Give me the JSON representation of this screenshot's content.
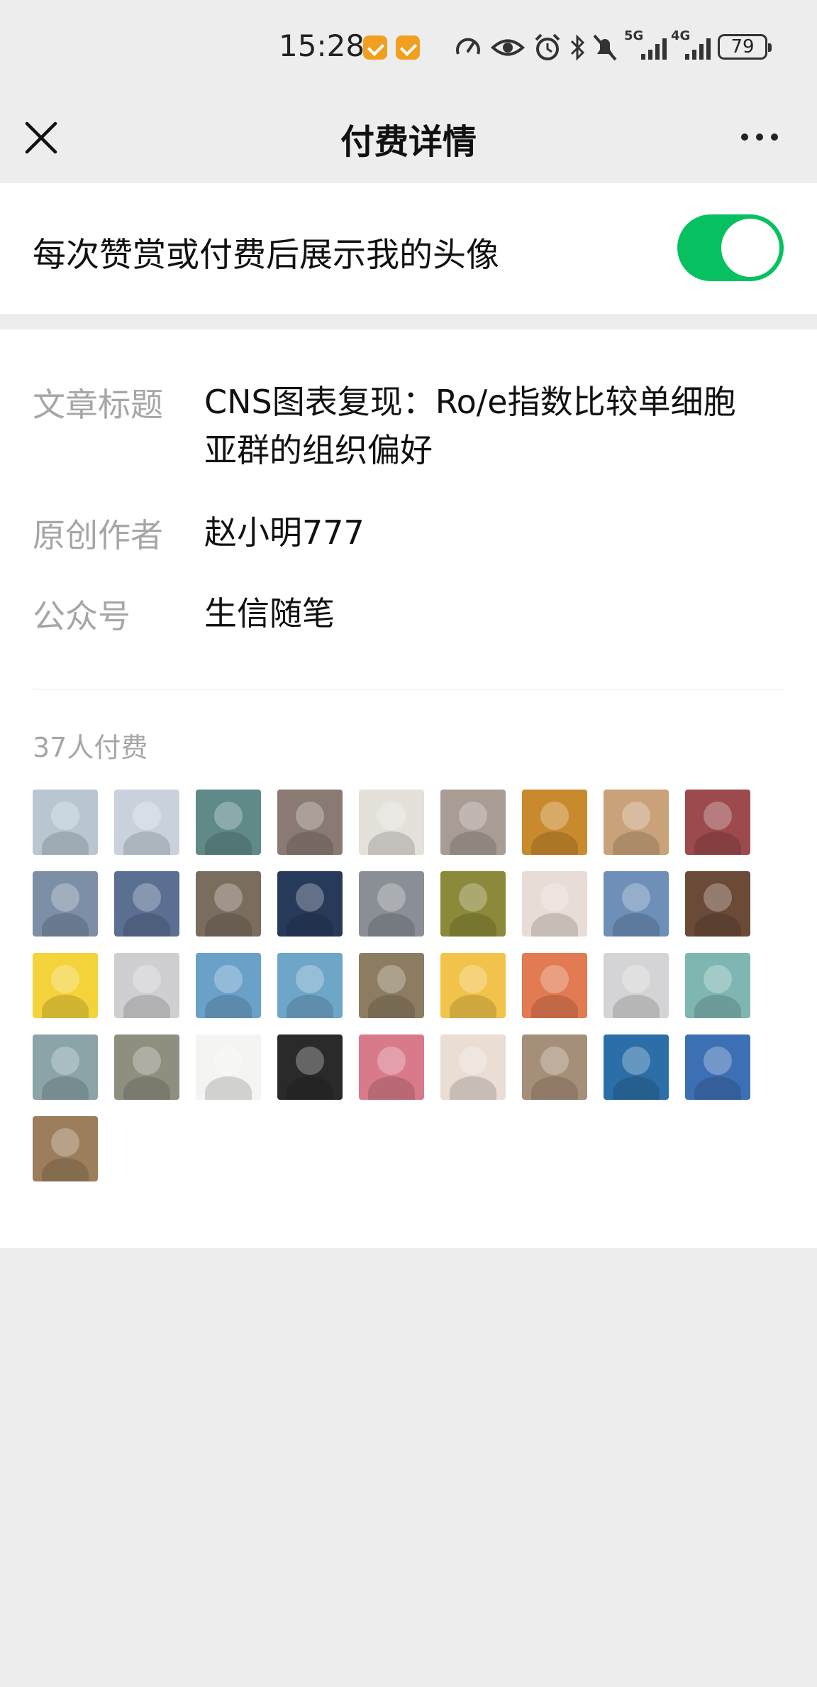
{
  "status_bar": {
    "time": "15:28",
    "network_1": "5G",
    "network_2": "4G",
    "battery": "79",
    "icons": [
      "app-notification-icon",
      "app-notification-icon",
      "speed-icon",
      "eye-icon",
      "alarm-icon",
      "bluetooth-icon",
      "mute-icon",
      "signal-icon",
      "signal-icon",
      "battery-icon"
    ]
  },
  "nav": {
    "title": "付费详情",
    "close_icon": "close-icon",
    "more_icon": "more-icon"
  },
  "toggle": {
    "label": "每次赞赏或付费后展示我的头像",
    "enabled": true,
    "accent_color": "#07c160"
  },
  "details": {
    "article_title_label": "文章标题",
    "article_title_line1": "CNS图表复现：Ro/e指数比较单细胞",
    "article_title_line2": "亚群的组织偏好",
    "author_label": "原创作者",
    "author_value": "赵小明777",
    "account_label": "公众号",
    "account_value": "生信随笔"
  },
  "payers": {
    "count_text": "37人付费",
    "avatars": [
      "#b9c6d2",
      "#c9d2dc",
      "#5f8a88",
      "#8b7a74",
      "#e4e0da",
      "#a89c95",
      "#c98a2e",
      "#c9a27a",
      "#9c4a4c",
      "#7c8fa6",
      "#5a6f92",
      "#7a6d5e",
      "#283a5a",
      "#8a8f96",
      "#8a8a3a",
      "#e8dcd6",
      "#6d8fb8",
      "#6b4a38",
      "#f4d23a",
      "#cfcfd2",
      "#6aa1c9",
      "#6ea6c8",
      "#8c7d62",
      "#f1c34a",
      "#e27a52",
      "#d4d4d6",
      "#7fb6b2",
      "#8aa4a8",
      "#8f8f80",
      "#f4f4f2",
      "#2a2a2a",
      "#d87a8a",
      "#e9ddd4",
      "#a68f78",
      "#2c6fa8",
      "#3d6fb5",
      "#9c7e5c"
    ]
  }
}
